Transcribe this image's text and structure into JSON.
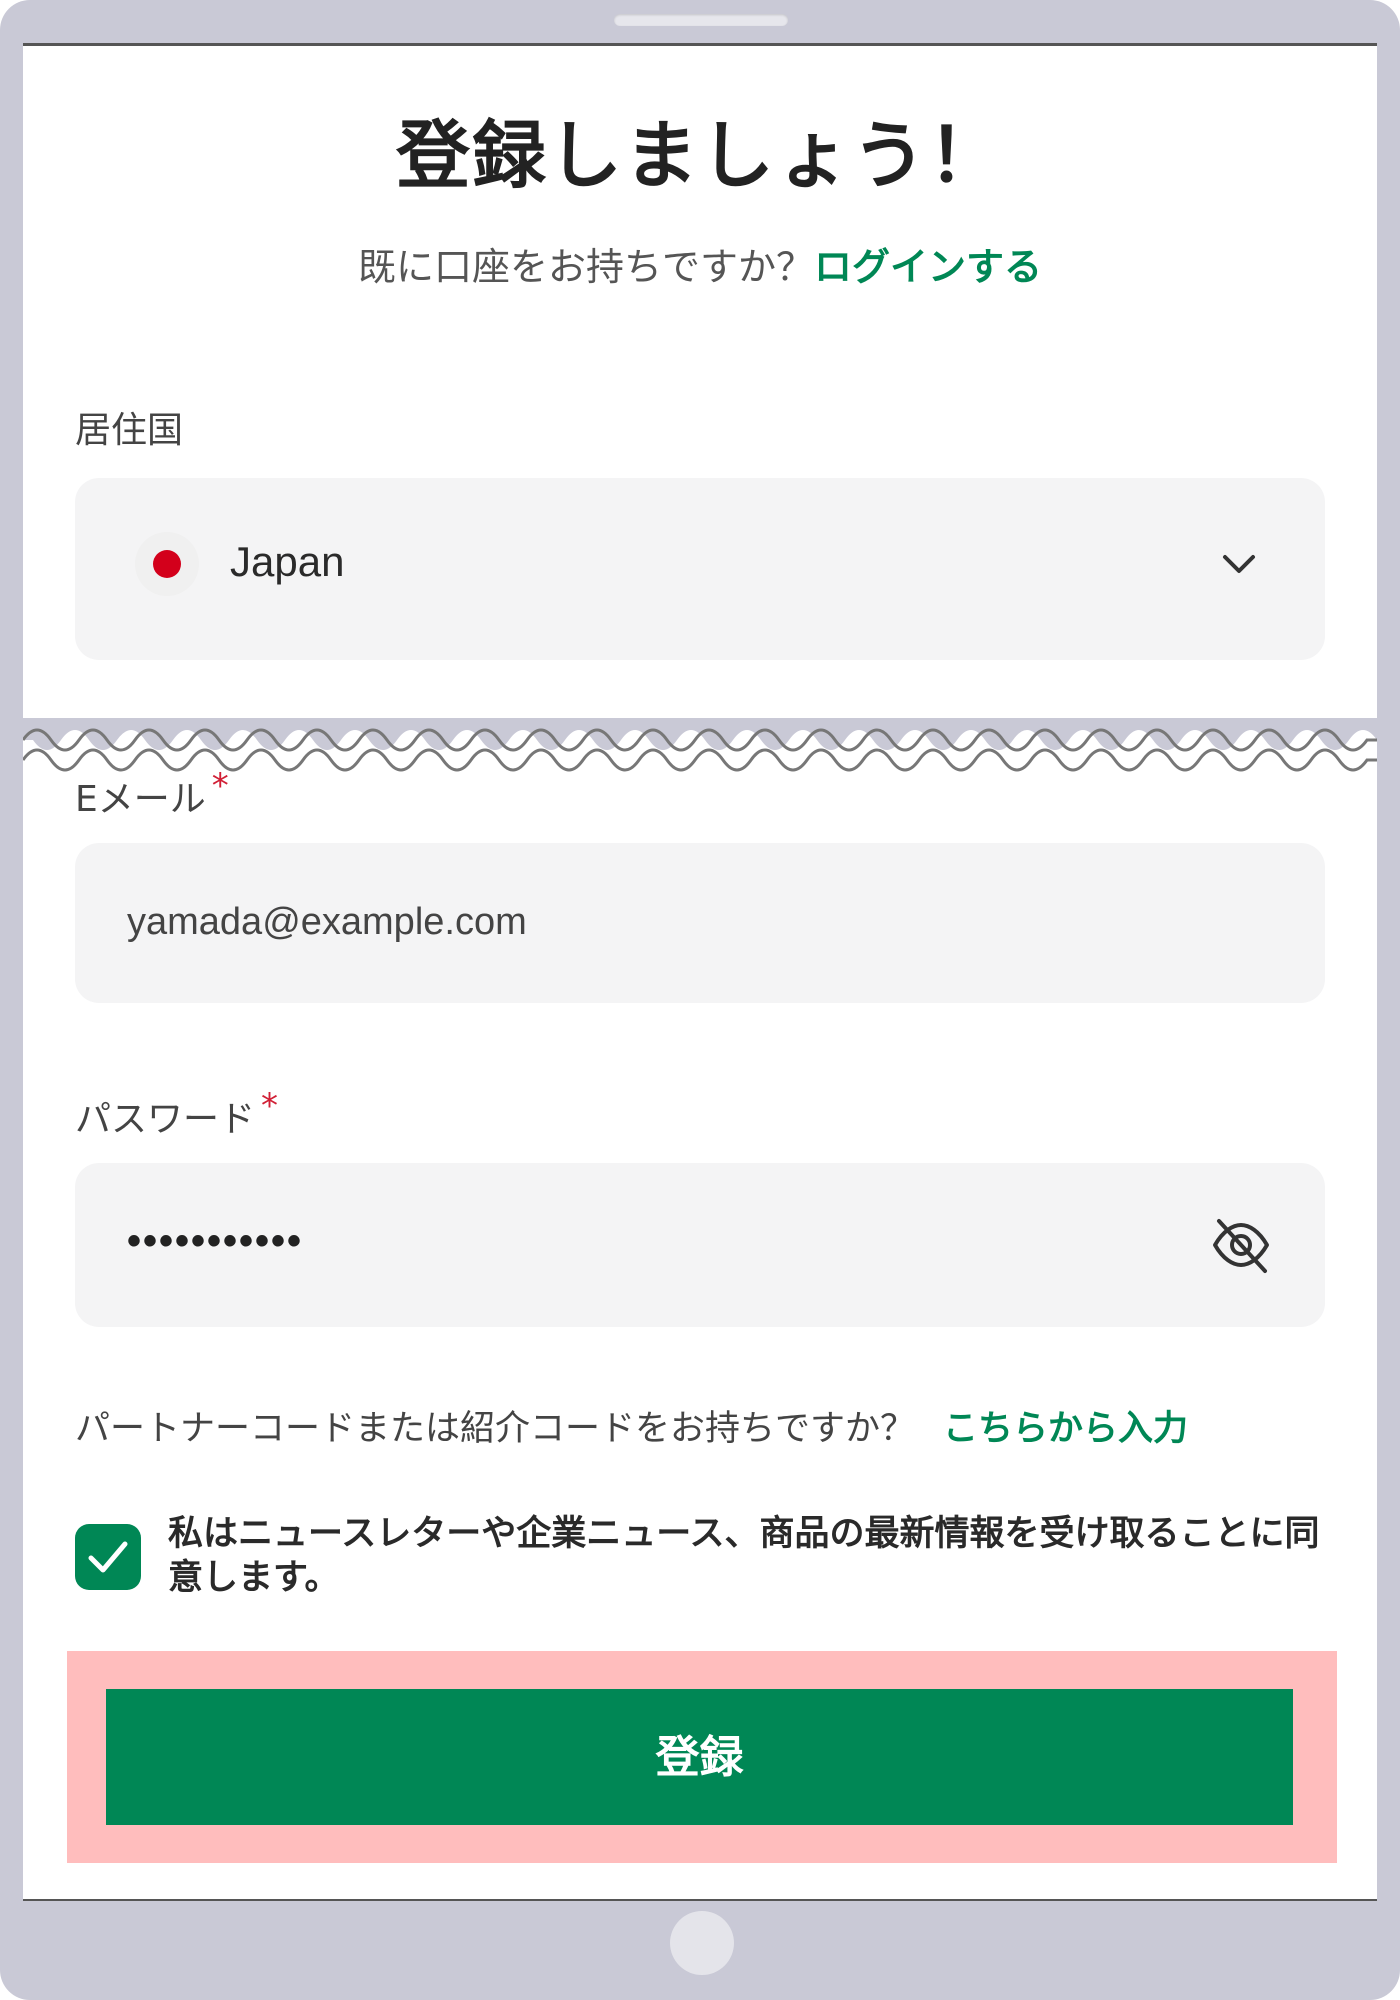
{
  "page": {
    "title": "登録しましょう！",
    "login_prompt": "既に口座をお持ちですか？",
    "login_link": "ログインする"
  },
  "country": {
    "label": "居住国",
    "value": "Japan",
    "flag_icon": "japan-flag-icon"
  },
  "email": {
    "label": "Eメール",
    "required_mark": "*",
    "value": "yamada@example.com"
  },
  "password": {
    "label": "パスワード",
    "required_mark": "*",
    "masked_value": "•••••••••••",
    "toggle_icon": "eye-slash-icon"
  },
  "partner": {
    "prompt": "パートナーコードまたは紹介コードをお持ちですか？",
    "link": "こちらから入力"
  },
  "consent": {
    "checked": true,
    "text": "私はニュースレターや企業ニュース、商品の最新情報を受け取ることに同意します。"
  },
  "submit": {
    "label": "登録"
  },
  "colors": {
    "accent": "#008755",
    "required": "#d11f35",
    "highlight": "#ffbdbd",
    "field_bg": "#f4f4f5"
  }
}
